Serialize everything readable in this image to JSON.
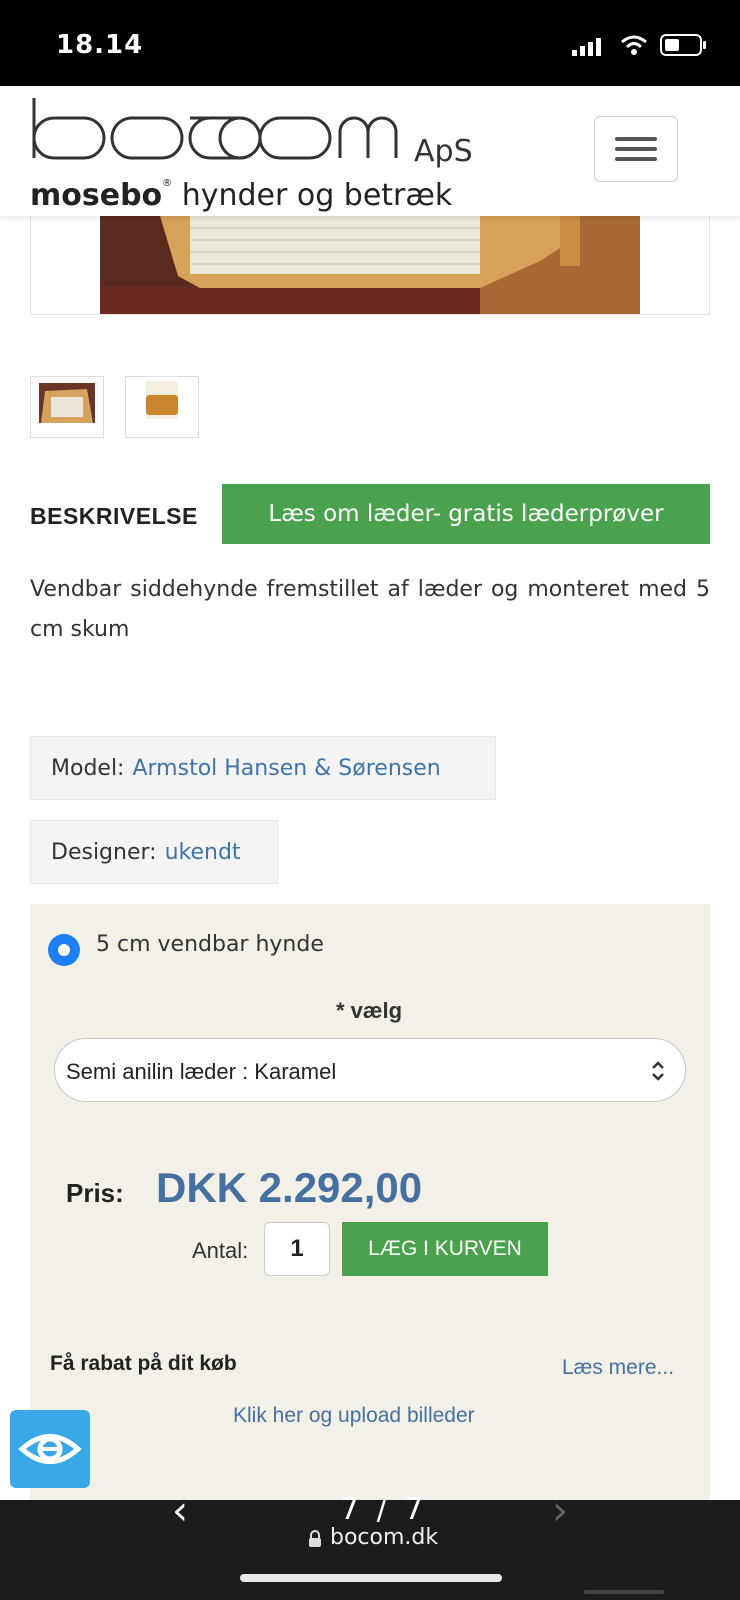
{
  "status_bar": {
    "time": "18.14"
  },
  "header": {
    "logo_brand": "bocom",
    "logo_suffix": "ApS",
    "tagline_brand": "mosebo",
    "tagline_rest": " hynder og betræk"
  },
  "description": {
    "heading": "BESKRIVELSE",
    "leather_button": "Læs om læder- gratis læderprøver",
    "text": "Vendbar siddehynde fremstillet af læder og monteret med 5 cm skum"
  },
  "specs": {
    "model_label": "Model:",
    "model_value": "Armstol Hansen & Sørensen",
    "designer_label": "Designer:",
    "designer_value": "ukendt"
  },
  "options": {
    "option_label": "5 cm vendbar hynde",
    "choose_label": "* vælg",
    "material_selected": "Semi anilin læder : Karamel"
  },
  "purchase": {
    "price_label": "Pris:",
    "price_value": "DKK 2.292,00",
    "quantity_label": "Antal:",
    "quantity_value": "1",
    "add_to_cart": "LÆG I KURVEN"
  },
  "extras": {
    "discount_label": "Få rabat på dit køb",
    "read_more": "Læs mere...",
    "upload_link": "Klik her og upload billeder"
  },
  "browser": {
    "pager": "7 / 7",
    "url": "bocom.dk"
  },
  "colors": {
    "accent_green": "#4aa24e",
    "link_blue": "#45709f",
    "panel_bg": "#f3f0e7",
    "radio_blue": "#1c7ff3",
    "widget_blue": "#3aa8e6"
  }
}
